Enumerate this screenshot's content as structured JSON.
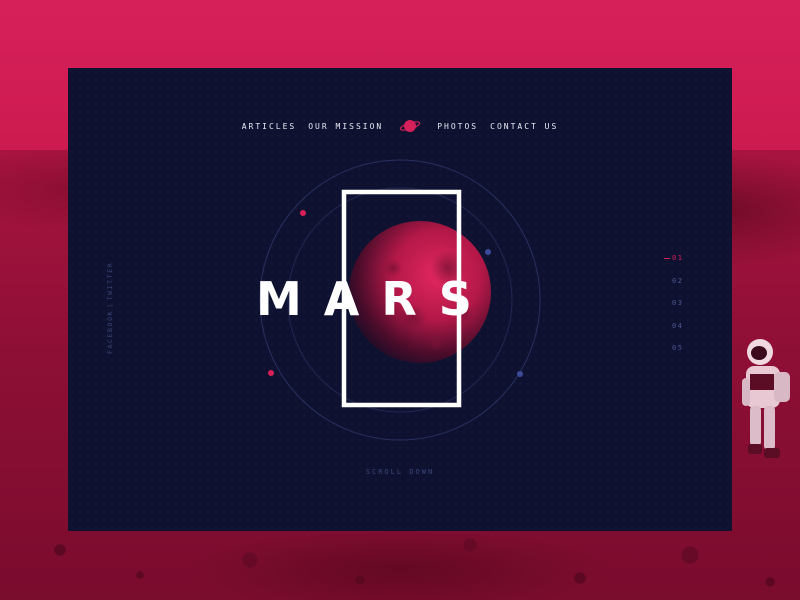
{
  "nav": {
    "items": [
      "ARTICLES",
      "OUR MISSION",
      "PHOTOS",
      "CONTACT US"
    ],
    "logo_icon": "planet-icon"
  },
  "hero": {
    "title": "MARS"
  },
  "social": {
    "facebook": "FACEBOOK",
    "separator": "|",
    "twitter": "TWITTER"
  },
  "pager": {
    "pages": [
      "01",
      "02",
      "03",
      "04",
      "05"
    ],
    "active_index": 0
  },
  "scroll": {
    "label": "SCROLL DOWN"
  },
  "colors": {
    "accent": "#d6205a",
    "panel": "#0e1230",
    "muted": "#4e5690",
    "text": "#ffffff"
  }
}
